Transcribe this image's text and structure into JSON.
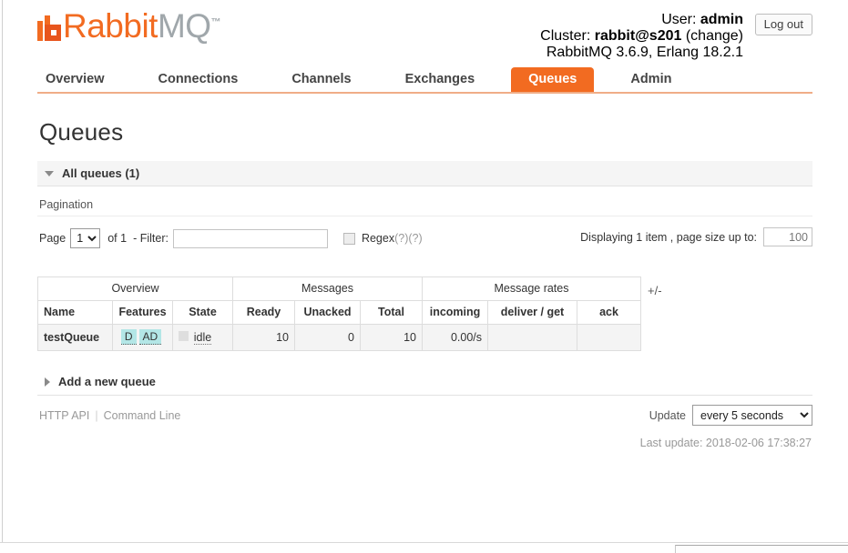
{
  "header": {
    "logo": {
      "rabbit": "Rabbit",
      "mq": "MQ",
      "tm": "™",
      "icon": "rabbitmq-logo-icon"
    },
    "user_label": "User:",
    "user_value": "admin",
    "cluster_label": "Cluster:",
    "cluster_value": "rabbit@s201",
    "cluster_change_link": "change",
    "version_label": "RabbitMQ 3.6.9,",
    "erlang_link": "Erlang 18.2.1",
    "logout_label": "Log out",
    "paren_open": "(",
    "paren_close": ")"
  },
  "nav": {
    "items": [
      {
        "label": "Overview",
        "selected": false
      },
      {
        "label": "Connections",
        "selected": false
      },
      {
        "label": "Channels",
        "selected": false
      },
      {
        "label": "Exchanges",
        "selected": false
      },
      {
        "label": "Queues",
        "selected": true
      },
      {
        "label": "Admin",
        "selected": false
      }
    ],
    "accent_color": "#f26b21",
    "underline_color": "#f0ad87"
  },
  "page": {
    "title": "Queues",
    "all_queues_section": "All queues (1)",
    "add_queue_section": "Add a new queue"
  },
  "pagination": {
    "label": "Pagination",
    "page_label": "Page",
    "page_value": "1",
    "page_options": [
      "1"
    ],
    "of_label": "of 1",
    "filter_label": "- Filter:",
    "filter_value": "",
    "filter_placeholder": "",
    "regex_label": "Regex",
    "regex_help": "(?)(?)",
    "regex_checked": false,
    "displaying_label": "Displaying 1 item , page size up to:",
    "page_size_value": "100"
  },
  "table": {
    "group_headers": [
      {
        "label": "Overview",
        "span": 3
      },
      {
        "label": "Messages",
        "span": 3
      },
      {
        "label": "Message rates",
        "span": 3
      }
    ],
    "columns": [
      "Name",
      "Features",
      "State",
      "Ready",
      "Unacked",
      "Total",
      "incoming",
      "deliver / get",
      "ack"
    ],
    "plus_minus": "+/-",
    "rows": [
      {
        "name": "testQueue",
        "features": [
          "D",
          "AD"
        ],
        "state": "idle",
        "ready": "10",
        "unacked": "0",
        "total": "10",
        "incoming": "0.00/s",
        "deliver_get": "",
        "ack": ""
      }
    ]
  },
  "footer": {
    "http_api": "HTTP API",
    "command_line": "Command Line",
    "update_label": "Update",
    "update_value": "every 5 seconds",
    "update_options": [
      "every 5 seconds"
    ],
    "last_update": "Last update: 2018-02-06 17:38:27"
  },
  "colors": {
    "accent": "#f26b21",
    "badge_bg": "#b3e6e6",
    "row_bg": "#f4f4f4",
    "section_bg": "#f5f5f5"
  }
}
